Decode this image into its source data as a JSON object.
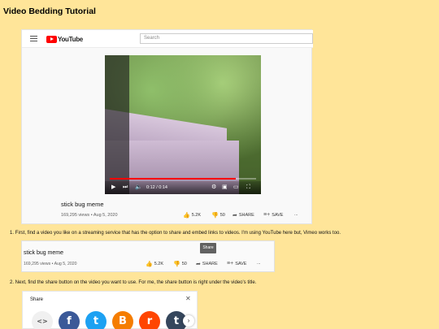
{
  "page": {
    "title": "Video Bedding Tutorial"
  },
  "youtube": {
    "logo_text": "YouTube",
    "search_placeholder": "Search",
    "video": {
      "progress": 0.86,
      "time": "0:12 / 0:14",
      "title": "stick bug meme",
      "meta": "169,295 views • Aug 5, 2020",
      "likes": "5.2K",
      "dislikes": "50",
      "share_label": "SHARE",
      "save_label": "SAVE",
      "more": "..."
    }
  },
  "steps": [
    "1. First, find a video you like on a streaming service that has the option to share and embed links to videos. I'm using YouTube here but, Vimeo works too.",
    "2. Next, find the share button on the video you want to use. For me, the share button is right under the video's title."
  ],
  "share_tooltip": "Share",
  "share_dialog": {
    "title": "Share",
    "close_glyph": "✕",
    "targets": [
      {
        "name": "embed",
        "glyph": "<>",
        "color": "#f0f0f0"
      },
      {
        "name": "facebook",
        "glyph": "f",
        "color": "#3b5998"
      },
      {
        "name": "twitter",
        "glyph": "t",
        "color": "#1da1f2"
      },
      {
        "name": "blogger",
        "glyph": "B",
        "color": "#f57d00"
      },
      {
        "name": "reddit",
        "glyph": "r",
        "color": "#ff4500"
      },
      {
        "name": "tumblr",
        "glyph": "t",
        "color": "#35465c"
      }
    ],
    "next_glyph": "›"
  }
}
